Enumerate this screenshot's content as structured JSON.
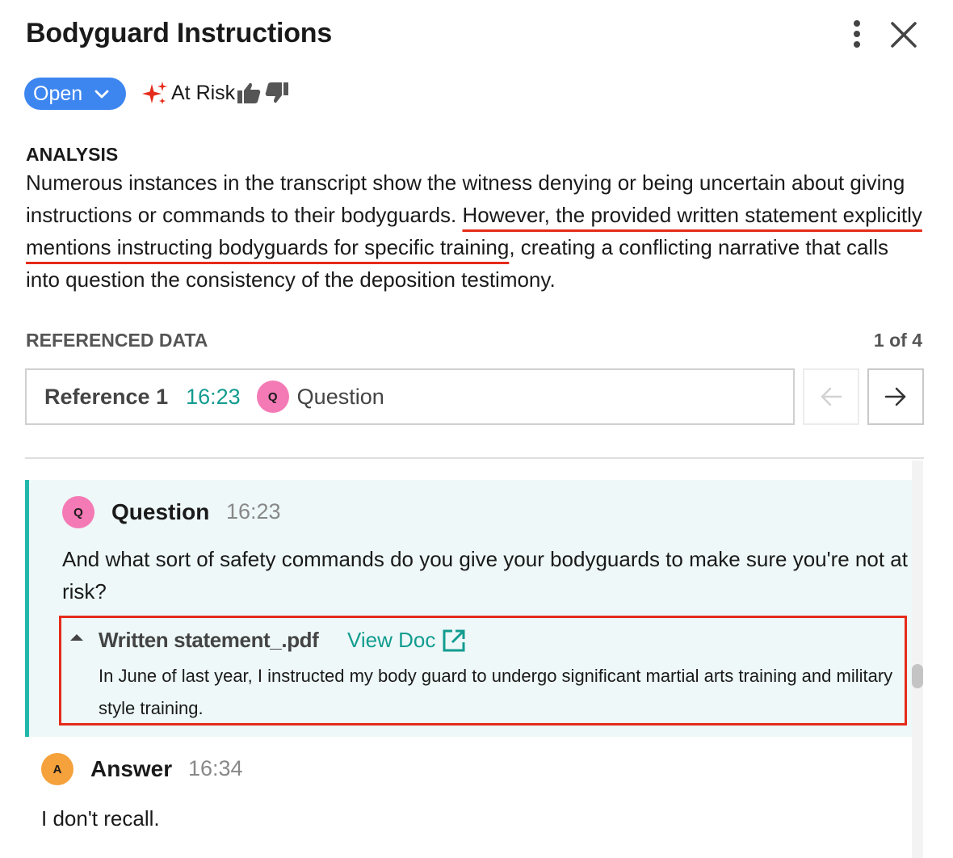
{
  "header": {
    "title": "Bodyguard Instructions"
  },
  "status": {
    "value": "Open",
    "risk_label": "At Risk",
    "accent_color": "#3d86f0",
    "risk_icon_color": "#e52b1a"
  },
  "analysis": {
    "heading": "ANALYSIS",
    "text_before": "Numerous instances in the transcript show the witness denying or being uncertain about giving instructions or commands to their bodyguards. ",
    "text_highlight": "However, the provided written statement explicitly mentions instructing bodyguards for specific training",
    "text_after": ", creating a conflicting narrative that calls into question the consistency of the deposition testimony."
  },
  "referenced_data": {
    "heading": "REFERENCED DATA",
    "count": "1 of 4",
    "current": {
      "label": "Reference 1",
      "time": "16:23",
      "avatar": "Q",
      "type": "Question"
    }
  },
  "transcript": {
    "question": {
      "avatar": "Q",
      "speaker": "Question",
      "time": "16:23",
      "text": "And what sort of safety commands do you give your bodyguards to make sure you're not at risk?",
      "document": {
        "name": "Written statement_.pdf",
        "link_label": "View Doc",
        "quote": "In June of last year, I instructed my body guard to undergo significant martial arts training and military style training."
      }
    },
    "answer": {
      "avatar": "A",
      "speaker": "Answer",
      "time": "16:34",
      "text": "I don't recall."
    }
  },
  "icons": {
    "more": "more-vertical-icon",
    "close": "close-icon",
    "status_dropdown": "chevron-down-icon",
    "risk": "sparkle-icon",
    "thumbs_up": "thumbs-up-icon",
    "thumbs_down": "thumbs-down-icon",
    "prev": "arrow-left-icon",
    "next": "arrow-right-icon",
    "doc_toggle": "caret-up-icon",
    "external": "external-link-icon"
  },
  "colors": {
    "teal": "#129c90",
    "question_avatar": "#f47ab5",
    "answer_avatar": "#f5a23c",
    "highlight_border": "#e52b1a",
    "question_bg": "#eef8f8"
  }
}
